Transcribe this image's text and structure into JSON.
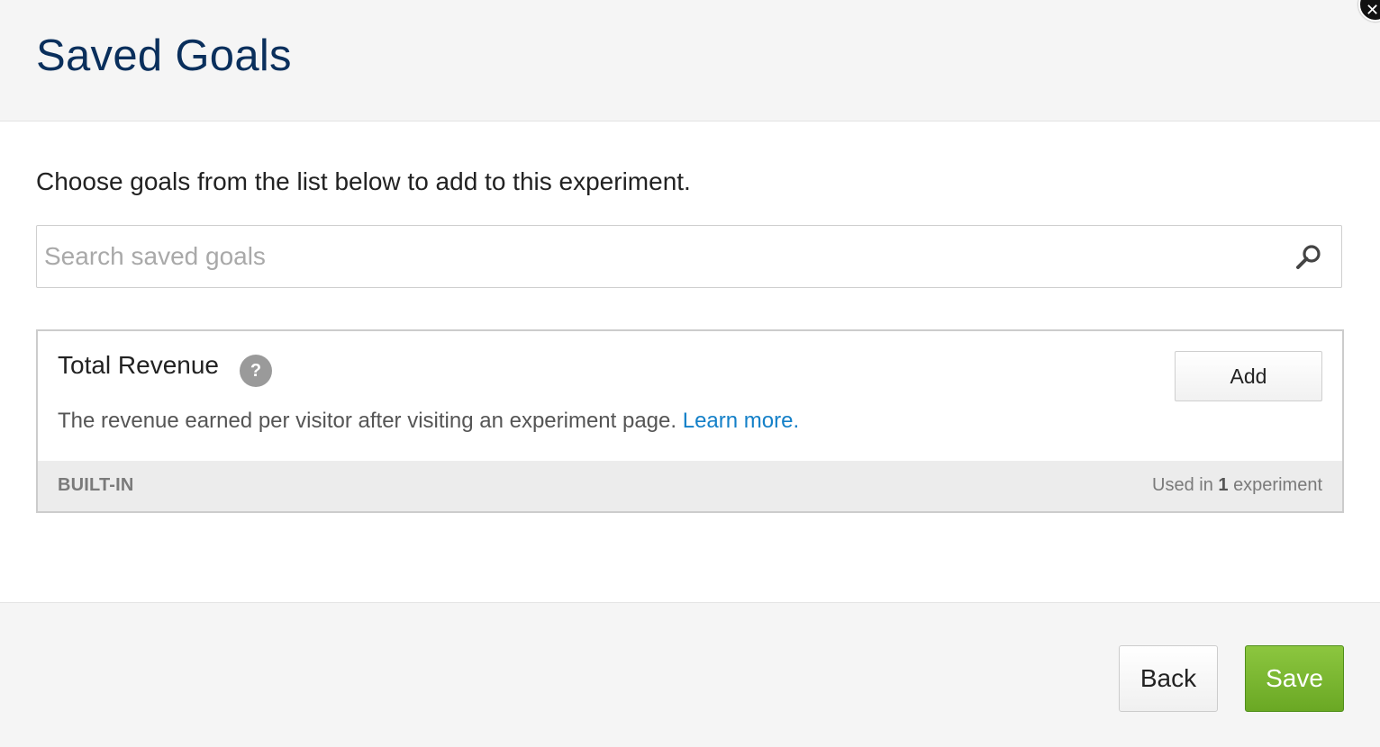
{
  "dialog": {
    "title": "Saved Goals",
    "instructions": "Choose goals from the list below to add to this experiment."
  },
  "search": {
    "placeholder": "Search saved goals",
    "value": ""
  },
  "goals": [
    {
      "name": "Total Revenue",
      "help_glyph": "?",
      "description": "The revenue earned per visitor after visiting an experiment page.",
      "learn_more": "Learn more.",
      "add_label": "Add",
      "type_label": "BUILT-IN",
      "usage_prefix": "Used in",
      "usage_count": "1",
      "usage_suffix": "experiment"
    }
  ],
  "footer": {
    "back_label": "Back",
    "save_label": "Save"
  },
  "icons": {
    "search": "search-icon",
    "help": "help-icon",
    "close": "close-icon"
  },
  "colors": {
    "title": "#0a2f5c",
    "link": "#1480c8",
    "save_button": "#7ab632",
    "header_bg": "#f5f5f5"
  }
}
